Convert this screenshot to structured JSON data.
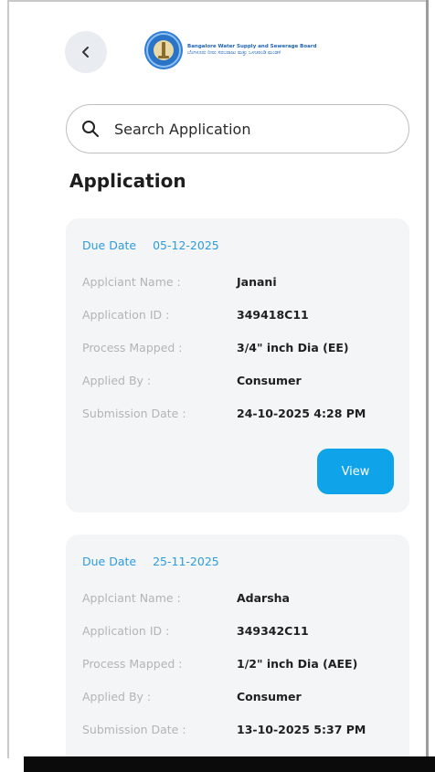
{
  "header": {
    "back_icon": "chevron-left-icon",
    "logo": {
      "line1": "Bangalore Water Supply and Sewerage Board",
      "line2": "ಬೆಂಗಳೂರು ನೀರು ಸರಬರಾಜು ಮತ್ತು ಒಳಚರಂಡಿ ಮಂಡಳಿ"
    }
  },
  "search": {
    "icon": "search-icon",
    "placeholder": "Search Application",
    "value": ""
  },
  "section_title": "Application",
  "colors": {
    "accent": "#0fa4ea",
    "due_text": "#2e9cde",
    "card_bg": "#f4f5f7",
    "label": "#b4b4b4"
  },
  "applications": [
    {
      "due_label": "Due Date",
      "due_date": "05-12-2025",
      "fields": [
        {
          "label": "Applciant Name :",
          "value": "Janani"
        },
        {
          "label": "Application ID :",
          "value": "349418C11"
        },
        {
          "label": "Process Mapped :",
          "value": "3/4\" inch Dia (EE)"
        },
        {
          "label": "Applied By :",
          "value": "Consumer"
        },
        {
          "label": "Submission Date :",
          "value": "24-10-2025 4:28 PM"
        }
      ],
      "view_label": "View"
    },
    {
      "due_label": "Due Date",
      "due_date": "25-11-2025",
      "fields": [
        {
          "label": "Applciant Name :",
          "value": "Adarsha"
        },
        {
          "label": "Application ID :",
          "value": "349342C11"
        },
        {
          "label": "Process Mapped :",
          "value": "1/2\" inch Dia (AEE)"
        },
        {
          "label": "Applied By :",
          "value": "Consumer"
        },
        {
          "label": "Submission Date :",
          "value": "13-10-2025 5:37 PM"
        }
      ]
    }
  ]
}
